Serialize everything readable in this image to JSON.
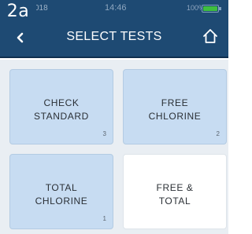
{
  "figure_tag": "2a",
  "status_bar": {
    "date": "018",
    "time": "14:46",
    "battery_percent": "100%",
    "battery_level": 1.0,
    "battery_color": "#3fbf3f"
  },
  "header": {
    "title": "SELECT TESTS",
    "back_icon": "chevron-left-icon",
    "home_icon": "home-icon",
    "background": "#1e4a73"
  },
  "tests": [
    {
      "label": "CHECK\nSTANDARD",
      "count": "3"
    },
    {
      "label": "FREE\nCHLORINE",
      "count": "2"
    },
    {
      "label": "TOTAL\nCHLORINE",
      "count": "1"
    },
    {
      "label": "FREE &\nTOTAL",
      "count": ""
    }
  ],
  "colors": {
    "tile_selected": "#c7dcf2",
    "tile_default": "#ffffff"
  }
}
